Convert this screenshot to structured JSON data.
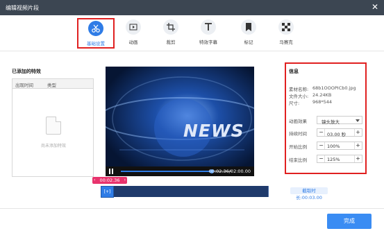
{
  "window": {
    "title": "编辑视频片段",
    "close_glyph": "✕"
  },
  "toolbar": {
    "tabs": [
      {
        "label": "基础设置",
        "icon": "scissors-icon",
        "active": true
      },
      {
        "label": "动画",
        "icon": "play-frame-icon"
      },
      {
        "label": "裁剪",
        "icon": "crop-icon"
      },
      {
        "label": "特效字幕",
        "icon": "text-icon"
      },
      {
        "label": "标记",
        "icon": "bookmark-icon"
      },
      {
        "label": "马赛克",
        "icon": "mosaic-icon"
      }
    ]
  },
  "effects": {
    "title": "已添加的特效",
    "columns": [
      "出现时间",
      "类型"
    ],
    "empty_text": "尚未添加特效"
  },
  "player": {
    "overlay_text": "NEWS",
    "time": "00:02.36/02:00.00",
    "progress": 0.82
  },
  "info": {
    "title": "信息",
    "rows": [
      {
        "label": "素材名称:",
        "value": "68b1OOOPICb0.jpg"
      },
      {
        "label": "文件大小:",
        "value": "24.24KB"
      },
      {
        "label": "尺寸:",
        "value": "968*544"
      }
    ],
    "animation": {
      "label": "动画效果",
      "value": "镜头放大"
    },
    "duration": {
      "label": "持续时间",
      "value": "03.00 秒"
    },
    "start_scale": {
      "label": "开始比例",
      "value": "100%"
    },
    "end_scale": {
      "label": "结束比例",
      "value": "125%"
    },
    "minus": "−",
    "plus": "+"
  },
  "timeline": {
    "current_time": "00:02.36",
    "arrow_left": "‹",
    "arrow_right": "›",
    "marker_label": "[+]",
    "cut_duration": "截取时长:00:03.00"
  },
  "footer": {
    "done_label": "完成"
  }
}
